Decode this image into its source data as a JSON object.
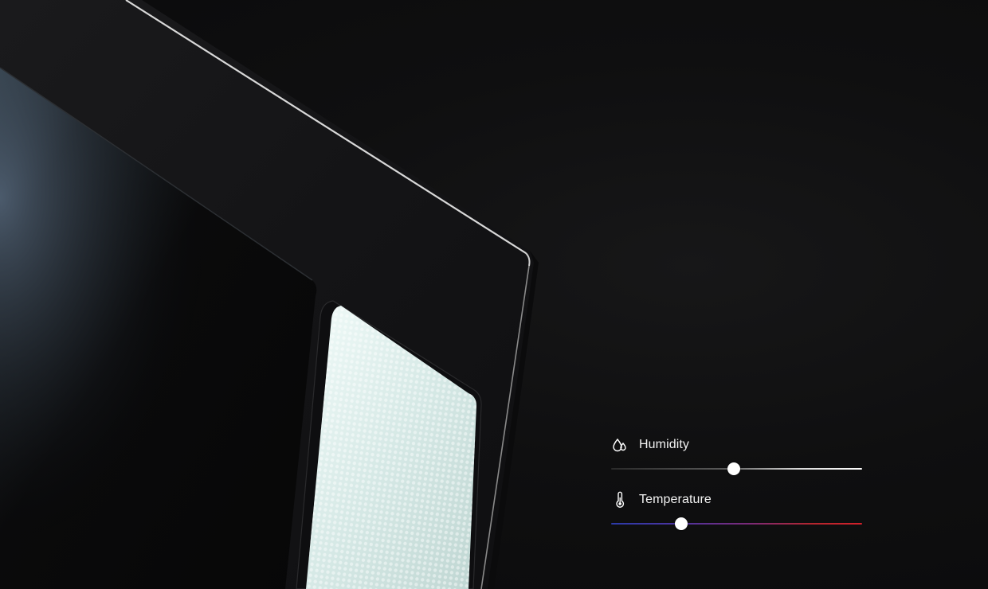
{
  "controls": {
    "humidity": {
      "label": "Humidity",
      "icon": "water-drops-icon",
      "level": 0.49
    },
    "temperature": {
      "label": "Temperature",
      "icon": "thermometer-icon",
      "level": 0.28
    }
  },
  "colors": {
    "background": "#0d0d0e",
    "frame": "#121214",
    "panel_glow": "#e4f1ef",
    "temperature_cold": "#2b3aa8",
    "temperature_hot": "#d3202a",
    "thumb": "#ffffff"
  }
}
